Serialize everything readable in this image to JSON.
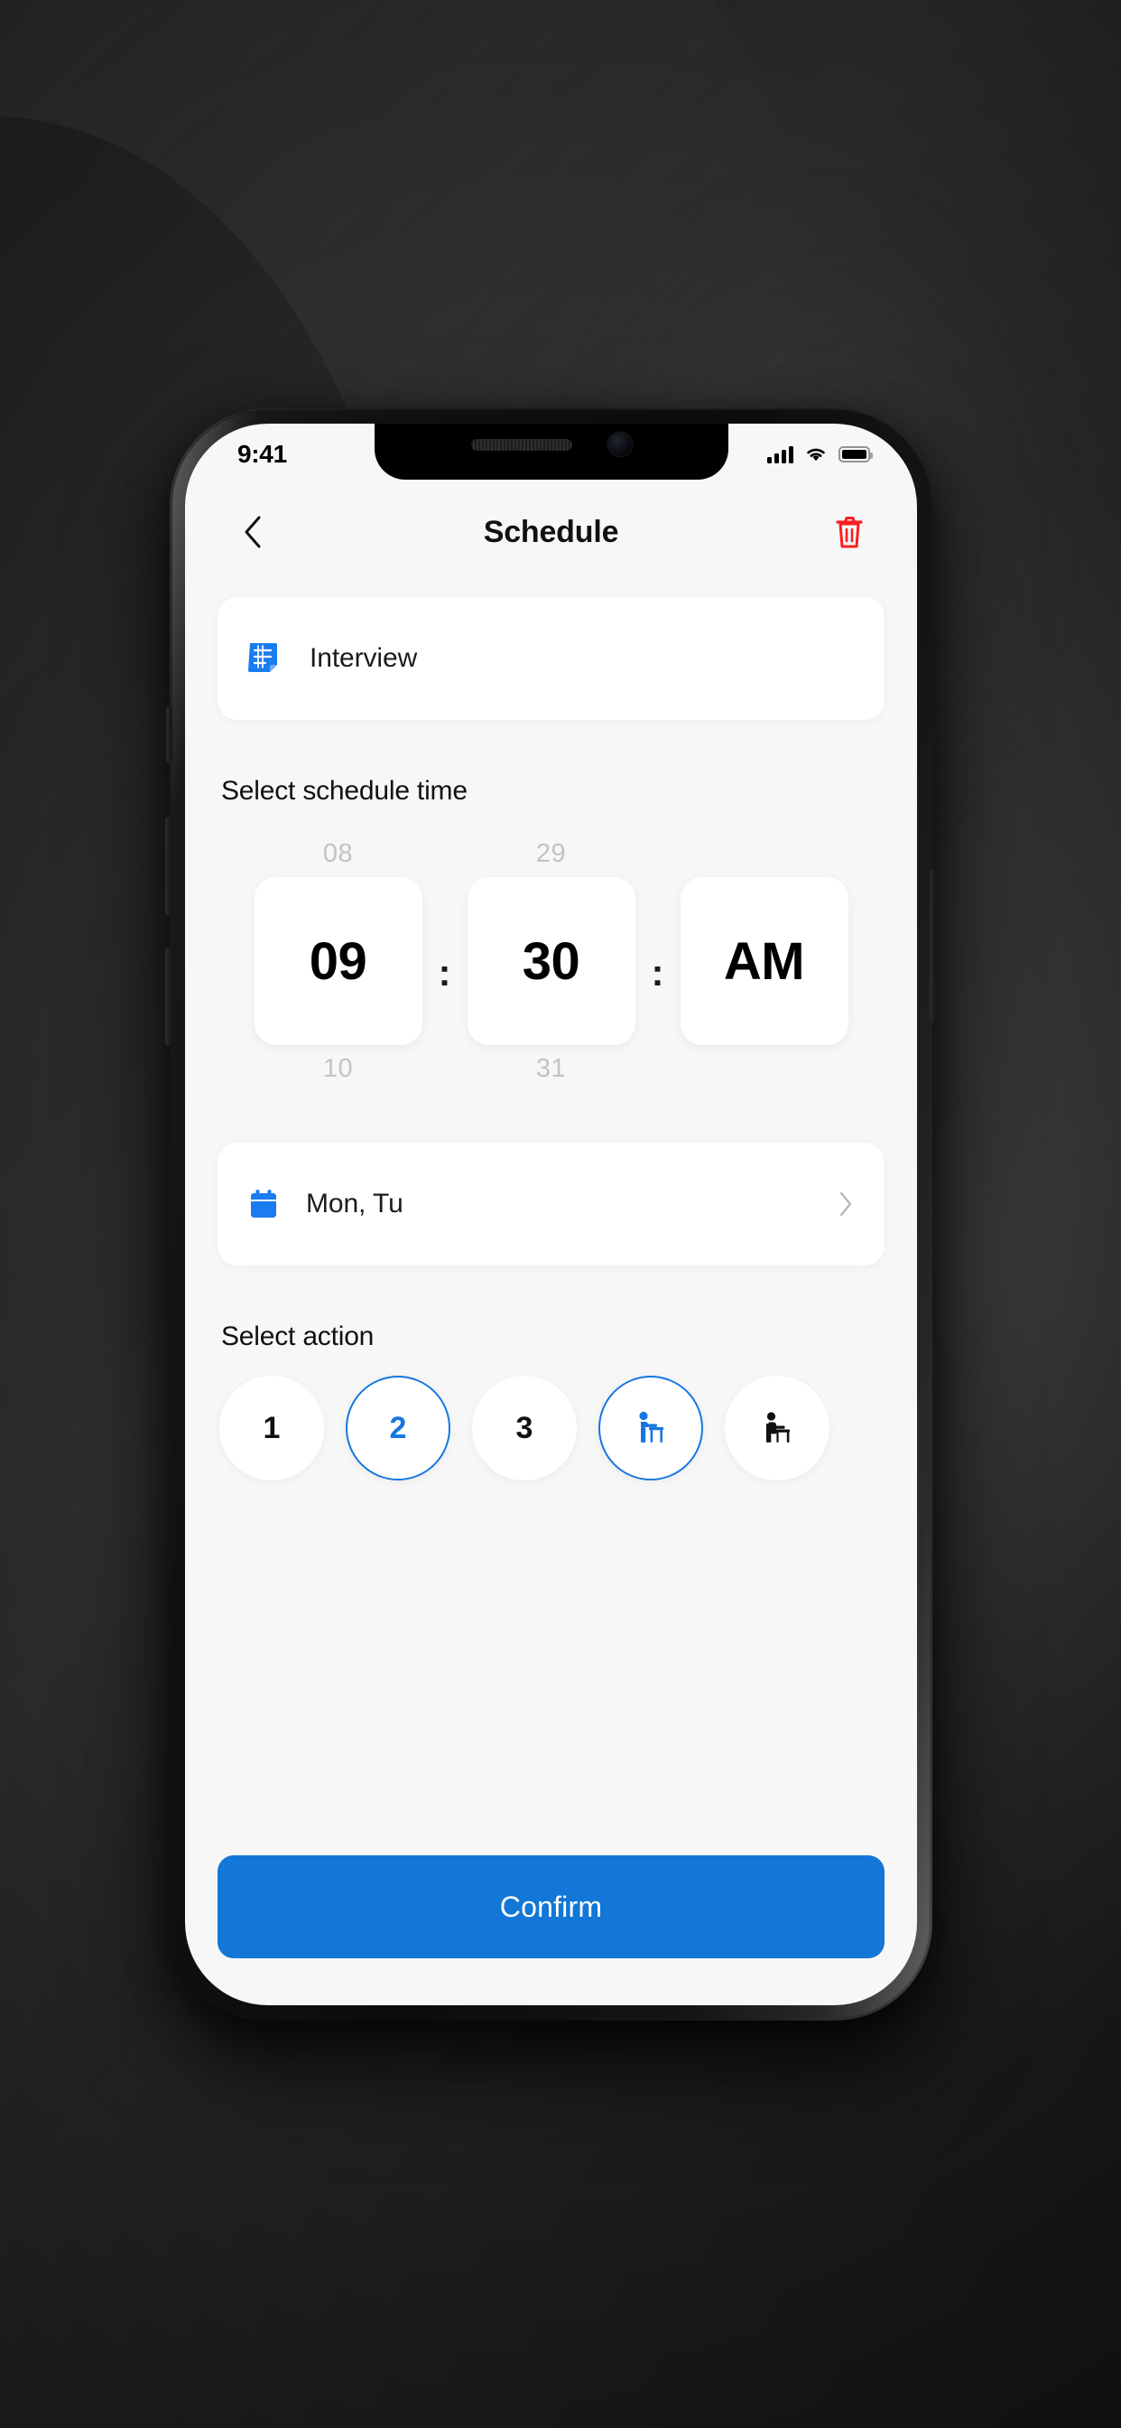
{
  "status_bar": {
    "time": "9:41",
    "signal_icon": "cellular-signal-icon",
    "wifi_icon": "wifi-icon",
    "battery_icon": "battery-full-icon"
  },
  "header": {
    "back_icon": "chevron-left-icon",
    "title": "Schedule",
    "delete_icon": "trash-icon",
    "delete_color": "#f81f1f"
  },
  "event_card": {
    "icon": "note-document-icon",
    "icon_color": "#1a7cf0",
    "label": "Interview"
  },
  "time_section": {
    "label": "Select schedule time",
    "separator": ":",
    "columns": [
      {
        "name": "hour",
        "above": "08",
        "value": "09",
        "below": "10"
      },
      {
        "name": "minute",
        "above": "29",
        "value": "30",
        "below": "31"
      },
      {
        "name": "meridiem",
        "above": "",
        "value": "AM",
        "below": ""
      }
    ]
  },
  "date_row": {
    "icon": "calendar-icon",
    "icon_color": "#1a7cf0",
    "label": "Mon, Tu",
    "chevron_icon": "chevron-right-icon"
  },
  "action_section": {
    "label": "Select action",
    "accent_color": "#1677e0",
    "options": [
      {
        "type": "text",
        "label": "1",
        "icon": "",
        "selected": false
      },
      {
        "type": "text",
        "label": "2",
        "icon": "",
        "selected": true
      },
      {
        "type": "text",
        "label": "3",
        "icon": "",
        "selected": false
      },
      {
        "type": "icon",
        "label": "",
        "icon": "person-standing-at-desk-icon",
        "selected": true
      },
      {
        "type": "icon",
        "label": "",
        "icon": "person-sitting-at-desk-icon",
        "selected": false
      }
    ]
  },
  "footer": {
    "confirm_label": "Confirm",
    "confirm_color": "#1277d6"
  }
}
